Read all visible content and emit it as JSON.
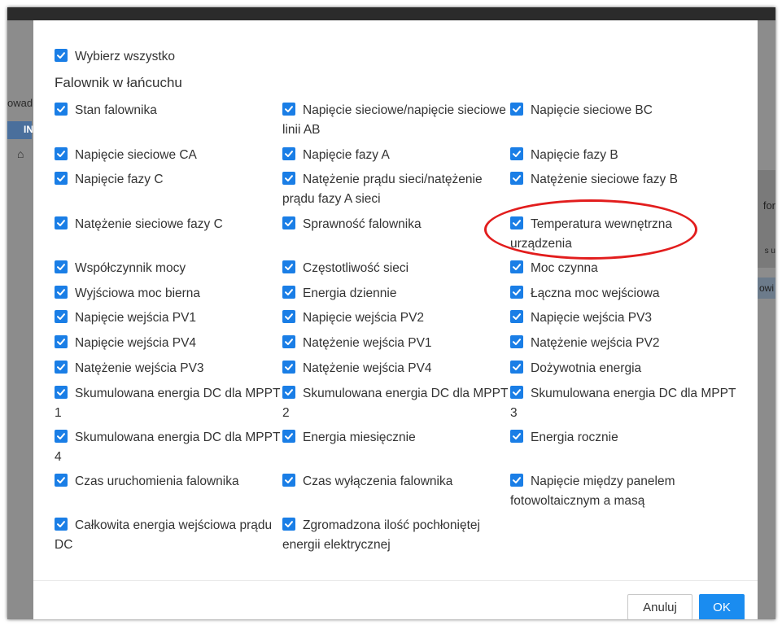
{
  "background": {
    "left_text": "owad",
    "left_button": "IN",
    "right_text": "for",
    "right_text_small": "s u",
    "right_text_row": "owi"
  },
  "dialog": {
    "select_all": "Wybierz wszystko",
    "section_title": "Falownik w łańcuchu",
    "items": [
      {
        "label": "Stan falownika",
        "checked": true
      },
      {
        "label": "Napięcie sieciowe/napięcie sieciowe linii AB",
        "checked": true
      },
      {
        "label": "Napięcie sieciowe BC",
        "checked": true
      },
      {
        "label": "Napięcie sieciowe CA",
        "checked": true
      },
      {
        "label": "Napięcie fazy A",
        "checked": true
      },
      {
        "label": "Napięcie fazy B",
        "checked": true
      },
      {
        "label": "Napięcie fazy C",
        "checked": true
      },
      {
        "label": "Natężenie prądu sieci/natężenie prądu fazy A sieci",
        "checked": true
      },
      {
        "label": "Natężenie sieciowe fazy B",
        "checked": true
      },
      {
        "label": "Natężenie sieciowe fazy C",
        "checked": true
      },
      {
        "label": "Sprawność falownika",
        "checked": true
      },
      {
        "label": "Temperatura wewnętrzna urządzenia",
        "checked": true
      },
      {
        "label": "Współczynnik mocy",
        "checked": true
      },
      {
        "label": "Częstotliwość sieci",
        "checked": true
      },
      {
        "label": "Moc czynna",
        "checked": true
      },
      {
        "label": "Wyjściowa moc bierna",
        "checked": true
      },
      {
        "label": "Energia dziennie",
        "checked": true
      },
      {
        "label": "Łączna moc wejściowa",
        "checked": true
      },
      {
        "label": "Napięcie wejścia PV1",
        "checked": true
      },
      {
        "label": "Napięcie wejścia PV2",
        "checked": true
      },
      {
        "label": "Napięcie wejścia PV3",
        "checked": true
      },
      {
        "label": "Napięcie wejścia PV4",
        "checked": true
      },
      {
        "label": "Natężenie wejścia PV1",
        "checked": true
      },
      {
        "label": "Natężenie wejścia PV2",
        "checked": true
      },
      {
        "label": "Natężenie wejścia PV3",
        "checked": true
      },
      {
        "label": "Natężenie wejścia PV4",
        "checked": true
      },
      {
        "label": "Dożywotnia energia",
        "checked": true
      },
      {
        "label": "Skumulowana energia DC dla MPPT 1",
        "checked": true
      },
      {
        "label": "Skumulowana energia DC dla MPPT 2",
        "checked": true
      },
      {
        "label": "Skumulowana energia DC dla MPPT 3",
        "checked": true
      },
      {
        "label": "Skumulowana energia DC dla MPPT 4",
        "checked": true
      },
      {
        "label": "Energia miesięcznie",
        "checked": true
      },
      {
        "label": "Energia rocznie",
        "checked": true
      },
      {
        "label": "Czas uruchomienia falownika",
        "checked": true
      },
      {
        "label": "Czas wyłączenia falownika",
        "checked": true
      },
      {
        "label": "Napięcie między panelem fotowoltaicznym a masą",
        "checked": true
      },
      {
        "label": "Całkowita energia wejściowa prądu DC",
        "checked": true
      },
      {
        "label": "Zgromadzona ilość pochłoniętej energii elektrycznej",
        "checked": true
      }
    ],
    "cancel_label": "Anuluj",
    "ok_label": "OK",
    "accent_color": "#1a7ee6",
    "highlight_color": "#e21d1d"
  }
}
